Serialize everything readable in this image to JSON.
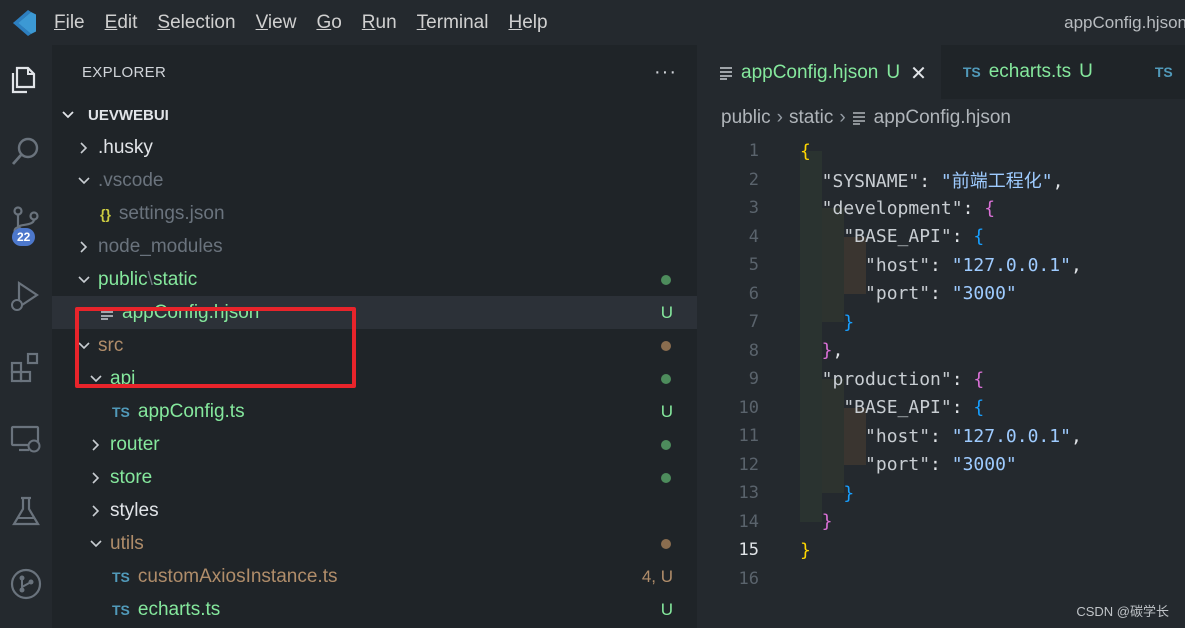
{
  "window": {
    "title": "appConfig.hjson"
  },
  "menu": [
    "File",
    "Edit",
    "Selection",
    "View",
    "Go",
    "Run",
    "Terminal",
    "Help"
  ],
  "menu_mnemonics": [
    "F",
    "E",
    "S",
    "V",
    "G",
    "R",
    "T",
    "H"
  ],
  "activity": {
    "scm_badge": "22"
  },
  "sidebar": {
    "title": "EXPLORER",
    "more": "···",
    "root": "UEVWEBUI",
    "tree": [
      {
        "indent": 0,
        "chevron": "right",
        "icon": "",
        "name": ".husky",
        "color": "white",
        "status": "",
        "dot": ""
      },
      {
        "indent": 0,
        "chevron": "down",
        "icon": "",
        "name": ".vscode",
        "color": "gray",
        "status": "",
        "dot": ""
      },
      {
        "indent": 1,
        "chevron": "",
        "icon": "json",
        "name": "settings.json",
        "color": "gray",
        "status": "",
        "dot": ""
      },
      {
        "indent": 0,
        "chevron": "right",
        "icon": "",
        "name": "node_modules",
        "color": "gray",
        "status": "",
        "dot": ""
      },
      {
        "indent": 0,
        "chevron": "down",
        "icon": "",
        "name": "public",
        "name2": "static",
        "color": "green",
        "status": "",
        "dot": "green"
      },
      {
        "indent": 1,
        "chevron": "",
        "icon": "hjson",
        "name": "appConfig.hjson",
        "color": "green",
        "status": "U",
        "dot": "",
        "selected": true
      },
      {
        "indent": 0,
        "chevron": "down",
        "icon": "",
        "name": "src",
        "color": "brown",
        "status": "",
        "dot": "brown"
      },
      {
        "indent": 1,
        "chevron": "down",
        "icon": "",
        "name": "api",
        "color": "green",
        "status": "",
        "dot": "green"
      },
      {
        "indent": 2,
        "chevron": "",
        "icon": "ts",
        "name": "appConfig.ts",
        "color": "green",
        "status": "U",
        "dot": ""
      },
      {
        "indent": 1,
        "chevron": "right",
        "icon": "",
        "name": "router",
        "color": "green",
        "status": "",
        "dot": "green"
      },
      {
        "indent": 1,
        "chevron": "right",
        "icon": "",
        "name": "store",
        "color": "green",
        "status": "",
        "dot": "green"
      },
      {
        "indent": 1,
        "chevron": "right",
        "icon": "",
        "name": "styles",
        "color": "white",
        "status": "",
        "dot": ""
      },
      {
        "indent": 1,
        "chevron": "down",
        "icon": "",
        "name": "utils",
        "color": "brown",
        "status": "",
        "dot": "brown"
      },
      {
        "indent": 2,
        "chevron": "",
        "icon": "ts",
        "name": "customAxiosInstance.ts",
        "color": "brown",
        "status": "4, U",
        "dot": ""
      },
      {
        "indent": 2,
        "chevron": "",
        "icon": "ts",
        "name": "echarts.ts",
        "color": "green",
        "status": "U",
        "dot": ""
      }
    ]
  },
  "tabs": [
    {
      "icon": "hjson",
      "label": "appConfig.hjson",
      "status": "U",
      "active": true,
      "close": "✕"
    },
    {
      "icon": "ts",
      "label": "echarts.ts",
      "status": "U",
      "active": false
    },
    {
      "icon": "ts",
      "label": "",
      "status": "",
      "active": false
    }
  ],
  "ts_icon_text": "TS",
  "json_icon_text": "{}",
  "breadcrumb": [
    "public",
    "static",
    "appConfig.hjson"
  ],
  "code": {
    "current_line": 15,
    "lines": [
      [
        [
          "b1",
          "{"
        ]
      ],
      [
        [
          "k",
          "  \"SYSNAME\""
        ],
        [
          "p",
          ": "
        ],
        [
          "s",
          "\"前端工程化\""
        ],
        [
          "p",
          ","
        ]
      ],
      [
        [
          "k",
          "  \"development\""
        ],
        [
          "p",
          ": "
        ],
        [
          "b2",
          "{"
        ]
      ],
      [
        [
          "k",
          "    \"BASE_API\""
        ],
        [
          "p",
          ": "
        ],
        [
          "b3",
          "{"
        ]
      ],
      [
        [
          "k",
          "      \"host\""
        ],
        [
          "p",
          ": "
        ],
        [
          "s",
          "\"127.0.0.1\""
        ],
        [
          "p",
          ","
        ]
      ],
      [
        [
          "k",
          "      \"port\""
        ],
        [
          "p",
          ": "
        ],
        [
          "s",
          "\"3000\""
        ]
      ],
      [
        [
          "b3",
          "    }"
        ]
      ],
      [
        [
          "b2",
          "  }"
        ],
        [
          "p",
          ","
        ]
      ],
      [
        [
          "k",
          "  \"production\""
        ],
        [
          "p",
          ": "
        ],
        [
          "b2",
          "{"
        ]
      ],
      [
        [
          "k",
          "    \"BASE_API\""
        ],
        [
          "p",
          ": "
        ],
        [
          "b3",
          "{"
        ]
      ],
      [
        [
          "k",
          "      \"host\""
        ],
        [
          "p",
          ": "
        ],
        [
          "s",
          "\"127.0.0.1\""
        ],
        [
          "p",
          ","
        ]
      ],
      [
        [
          "k",
          "      \"port\""
        ],
        [
          "p",
          ": "
        ],
        [
          "s",
          "\"3000\""
        ]
      ],
      [
        [
          "b3",
          "    }"
        ]
      ],
      [
        [
          "b2",
          "  }"
        ]
      ],
      [
        [
          "b1",
          "}"
        ]
      ],
      []
    ]
  },
  "watermark": "CSDN @碳学长",
  "colors": {
    "green": "#85e89d",
    "brown": "#b08d6a",
    "gray": "#6a737d",
    "white": "#e1e4e8",
    "accent": "#4d78cc",
    "highlight": "#e8242b"
  }
}
